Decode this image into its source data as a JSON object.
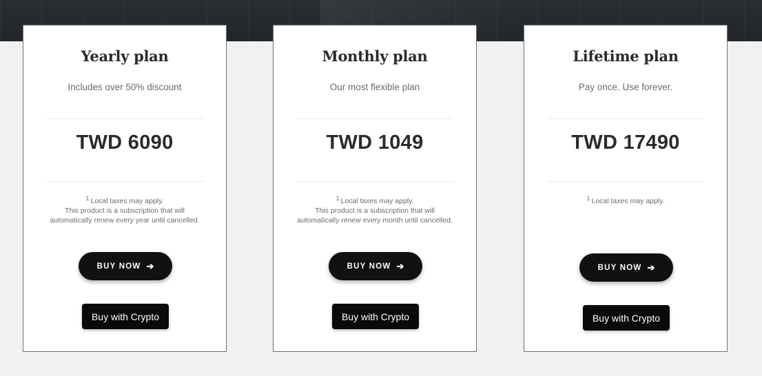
{
  "plans": [
    {
      "title": "Yearly plan",
      "subtitle": "Includes over 50% discount",
      "price": "TWD 6090",
      "footnote_marker": "1",
      "footnote": "Local taxes may apply.",
      "note_line_1": "This product is a subscription that will",
      "note_line_2": "automatically renew every year until cancelled.",
      "buy_now_label": "BUY NOW",
      "crypto_label": "Buy with Crypto"
    },
    {
      "title": "Monthly plan",
      "subtitle": "Our most flexible plan",
      "price": "TWD 1049",
      "footnote_marker": "1",
      "footnote": "Local taxes may apply.",
      "note_line_1": "This product is a subscription that will",
      "note_line_2": "automatically renew every month until cancelled.",
      "buy_now_label": "BUY NOW",
      "crypto_label": "Buy with Crypto"
    },
    {
      "title": "Lifetime plan",
      "subtitle": "Pay once. Use forever.",
      "price": "TWD 17490",
      "footnote_marker": "1",
      "footnote": "Local taxes may apply.",
      "buy_now_label": "BUY NOW",
      "crypto_label": "Buy with Crypto"
    }
  ],
  "icons": {
    "buy_now_arrow": "arrow-right-icon"
  },
  "colors": {
    "button": "#111111",
    "hero": "#2a2e33",
    "background": "#f1f1f1"
  }
}
